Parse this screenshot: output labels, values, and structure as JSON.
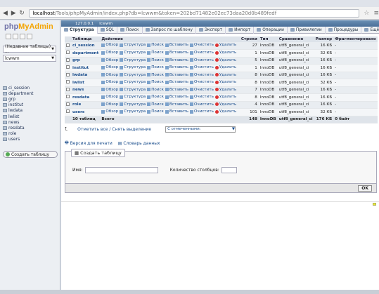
{
  "browser": {
    "url_host": "localhost",
    "url_rest": "/Tools/phpMyAdmin/index.php?db=lcwwm&token=202bd71482e02ec73daa20d0b489fedf"
  },
  "sidebar": {
    "logo_a": "php",
    "logo_b": "MyAdmin",
    "recent_tables": "(Недавние таблицы) ...",
    "db_select": "lcwwm",
    "tables": [
      "ci_session",
      "department",
      "grp",
      "institut",
      "lwdata",
      "lwlist",
      "news",
      "resdata",
      "role",
      "users"
    ],
    "create_table": "Создать таблицу"
  },
  "breadcrumb": {
    "server": "127.0.0.1",
    "db": "lcwwm"
  },
  "tabs": [
    "Структура",
    "SQL",
    "Поиск",
    "Запрос по шаблону",
    "Экспорт",
    "Импорт",
    "Операции",
    "Привилегии",
    "Процедуры",
    "Ещё"
  ],
  "table": {
    "headers": [
      "Таблица",
      "Действие",
      "Строки",
      "Тип",
      "Сравнение",
      "Размер",
      "Фрагментировано"
    ],
    "actions": [
      "Обзор",
      "Структура",
      "Поиск",
      "Вставить",
      "Очистить",
      "Удалить"
    ],
    "rows": [
      {
        "name": "ci_session",
        "rows": "27",
        "type": "InnoDB",
        "collation": "utf8_general_ci",
        "size": "16 КБ",
        "frag": "-"
      },
      {
        "name": "department",
        "rows": "1",
        "type": "InnoDB",
        "collation": "utf8_general_ci",
        "size": "32 КБ",
        "frag": "-"
      },
      {
        "name": "grp",
        "rows": "5",
        "type": "InnoDB",
        "collation": "utf8_general_ci",
        "size": "16 КБ",
        "frag": "-"
      },
      {
        "name": "institut",
        "rows": "1",
        "type": "InnoDB",
        "collation": "utf8_general_ci",
        "size": "16 КБ",
        "frag": "-"
      },
      {
        "name": "lwdata",
        "rows": "8",
        "type": "InnoDB",
        "collation": "utf8_general_ci",
        "size": "16 КБ",
        "frag": "-"
      },
      {
        "name": "lwlist",
        "rows": "8",
        "type": "InnoDB",
        "collation": "utf8_general_ci",
        "size": "32 КБ",
        "frag": "-"
      },
      {
        "name": "news",
        "rows": "7",
        "type": "InnoDB",
        "collation": "utf8_general_ci",
        "size": "16 КБ",
        "frag": "-"
      },
      {
        "name": "resdata",
        "rows": "8",
        "type": "InnoDB",
        "collation": "utf8_general_ci",
        "size": "16 КБ",
        "frag": "-"
      },
      {
        "name": "role",
        "rows": "4",
        "type": "InnoDB",
        "collation": "utf8_general_ci",
        "size": "16 КБ",
        "frag": "-"
      },
      {
        "name": "users",
        "rows": "101",
        "type": "InnoDB",
        "collation": "utf8_general_ci",
        "size": "32 КБ",
        "frag": "-"
      }
    ],
    "total": {
      "label": "10 таблиц",
      "sum": "Всего",
      "rows": "148",
      "type": "InnoDB",
      "collation": "utf8_general_ci",
      "size": "176 КБ",
      "frag": "0 байт"
    }
  },
  "bulk": {
    "check_all": "Отметить все / Снять выделение",
    "with_selected": "С отмеченными:"
  },
  "links": {
    "print": "Версия для печати",
    "dictionary": "Словарь данных"
  },
  "create": {
    "legend": "Создать таблицу",
    "name_label": "Имя:",
    "cols_label": "Количество столбцов:",
    "ok": "OK"
  }
}
